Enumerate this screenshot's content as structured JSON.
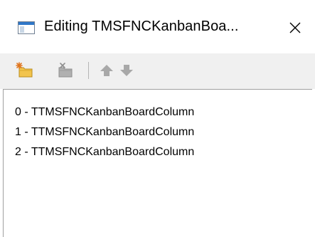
{
  "window": {
    "title": "Editing TMSFNCKanbanBoa...",
    "icon": "application-window-icon",
    "close_icon": "close-icon"
  },
  "toolbar": {
    "buttons": [
      {
        "name": "add-new-item-button",
        "icon": "new-item-sparkle-icon",
        "enabled": true
      },
      {
        "name": "delete-item-button",
        "icon": "delete-item-icon",
        "enabled": false
      },
      {
        "name": "move-up-button",
        "icon": "arrow-up-icon",
        "enabled": false
      },
      {
        "name": "move-down-button",
        "icon": "arrow-down-icon",
        "enabled": false
      }
    ]
  },
  "list": {
    "items": [
      {
        "label": "0 - TTMSFNCKanbanBoardColumn"
      },
      {
        "label": "1 - TTMSFNCKanbanBoardColumn"
      },
      {
        "label": "2 - TTMSFNCKanbanBoardColumn"
      }
    ]
  },
  "colors": {
    "toolbar_background": "#f0f0f0",
    "disabled_icon": "#a8a8a8",
    "accent_yellow": "#f5c542",
    "border": "#a0a0a0"
  }
}
